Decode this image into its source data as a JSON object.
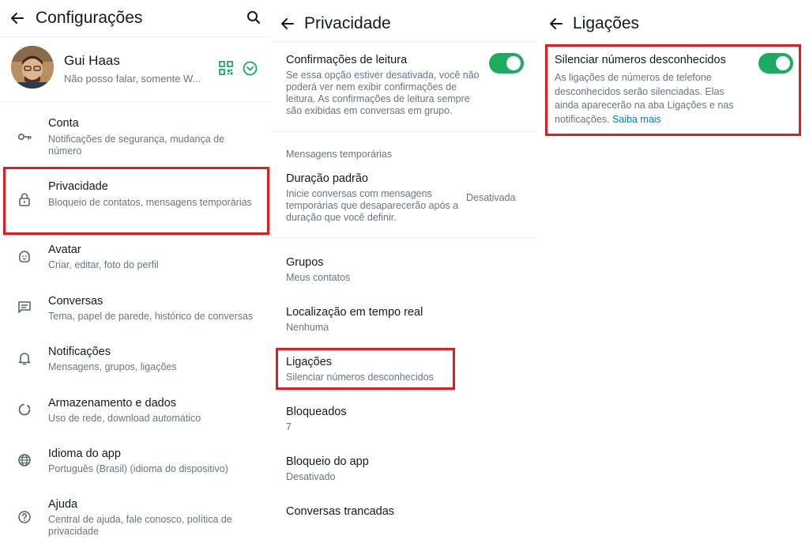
{
  "panel1": {
    "title": "Configurações",
    "profile": {
      "name": "Gui Haas",
      "status": "Não posso falar, somente W..."
    },
    "items": [
      {
        "label": "Conta",
        "sub": "Notificações de segurança, mudança de número",
        "icon": "key-icon"
      },
      {
        "label": "Privacidade",
        "sub": "Bloqueio de contatos, mensagens temporárias",
        "icon": "lock-icon"
      },
      {
        "label": "Avatar",
        "sub": "Criar, editar, foto do perfil",
        "icon": "avatar-icon"
      },
      {
        "label": "Conversas",
        "sub": "Tema, papel de parede, histórico de conversas",
        "icon": "chat-icon"
      },
      {
        "label": "Notificações",
        "sub": "Mensagens, grupos, ligações",
        "icon": "bell-icon"
      },
      {
        "label": "Armazenamento e dados",
        "sub": "Uso de rede, download automático",
        "icon": "storage-icon"
      },
      {
        "label": "Idioma do app",
        "sub": "Português (Brasil) (idioma do dispositivo)",
        "icon": "globe-icon"
      },
      {
        "label": "Ajuda",
        "sub": "Central de ajuda, fale conosco, política de privacidade",
        "icon": "help-icon"
      }
    ]
  },
  "panel2": {
    "title": "Privacidade",
    "read_receipts": {
      "label": "Confirmações de leitura",
      "sub": "Se essa opção estiver desativada, você não poderá ver nem exibir confirmações de leitura. As confirmações de leitura sempre são exibidas em conversas em grupo.",
      "enabled": true
    },
    "section_temp": "Mensagens temporárias",
    "default_duration": {
      "label": "Duração padrão",
      "sub": "Inicie conversas com mensagens temporárias que desaparecerão após a duração que você definir.",
      "value": "Desativada"
    },
    "rows": [
      {
        "label": "Grupos",
        "sub": "Meus contatos"
      },
      {
        "label": "Localização em tempo real",
        "sub": "Nenhuma"
      },
      {
        "label": "Ligações",
        "sub": "Silenciar números desconhecidos"
      },
      {
        "label": "Bloqueados",
        "sub": "7"
      },
      {
        "label": "Bloqueio do app",
        "sub": "Desativado"
      },
      {
        "label": "Conversas trancadas",
        "sub": ""
      }
    ]
  },
  "panel3": {
    "title": "Ligações",
    "silence": {
      "label": "Silenciar números desconhecidos",
      "sub": "As ligações de números de telefone desconhecidos serão silenciadas. Elas ainda aparecerão na aba Ligações e nas notificações.",
      "link": "Saiba mais",
      "enabled": true
    }
  },
  "colors": {
    "accent": "#1daa61",
    "highlight": "#e11b22",
    "link": "#027eb5",
    "secondary_text": "#667781"
  }
}
